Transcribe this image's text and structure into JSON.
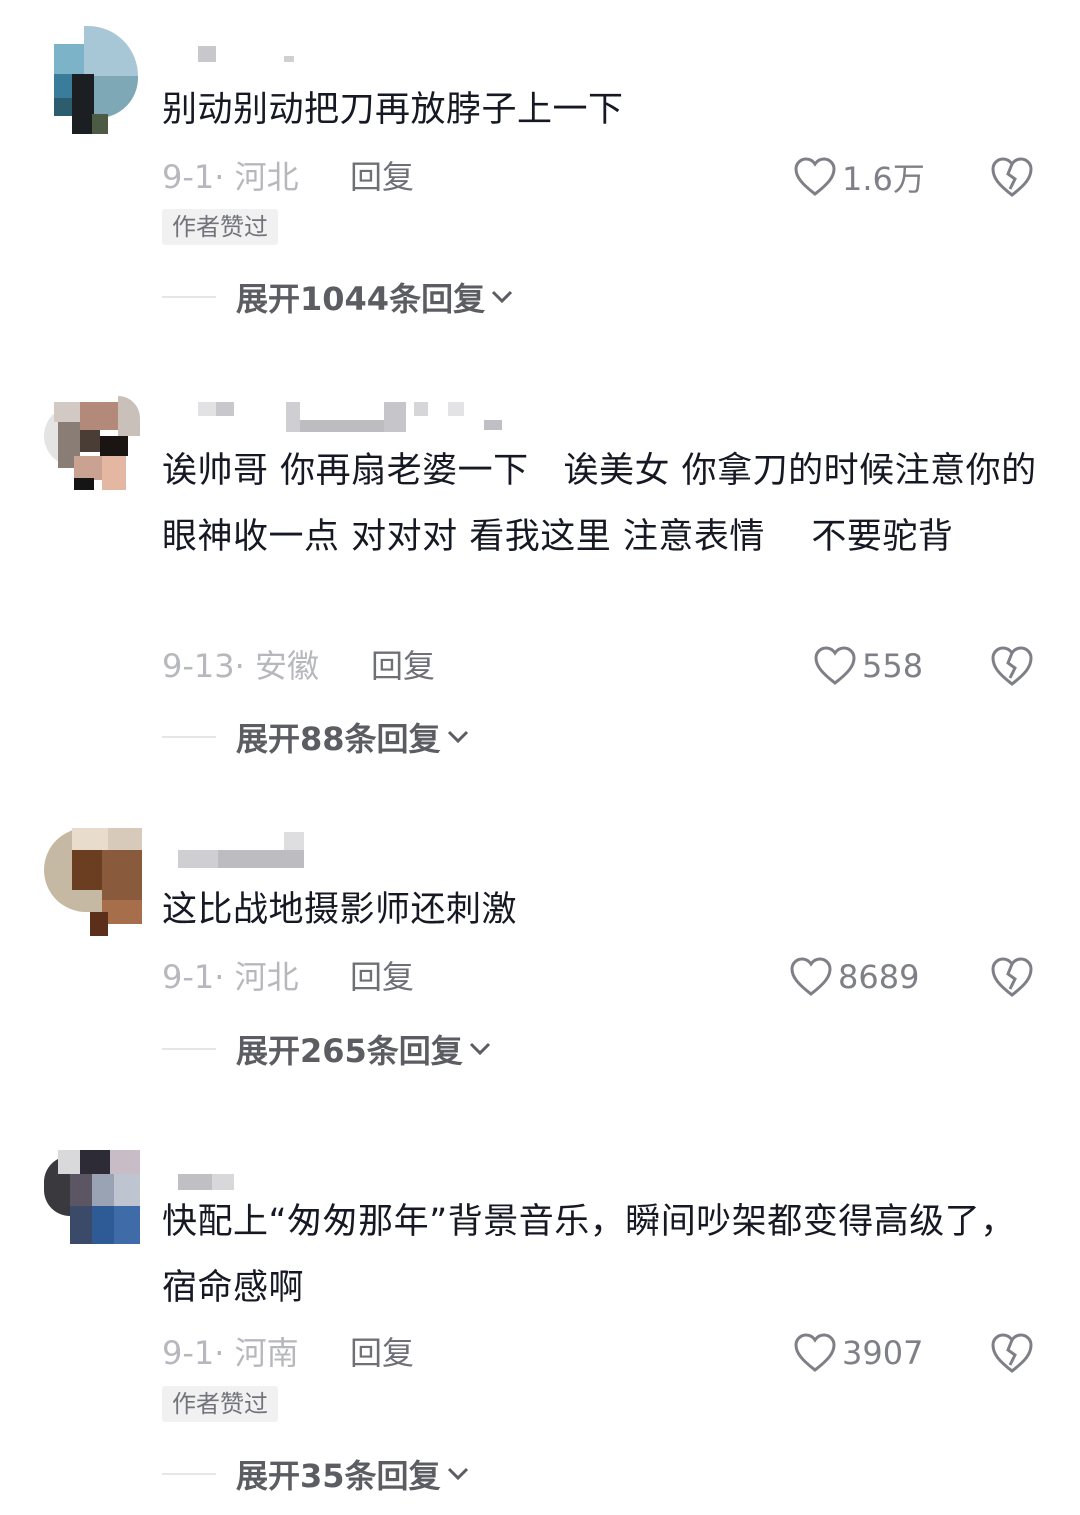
{
  "comments": [
    {
      "text": "别动别动把刀再放脖子上一下",
      "date_location": "9-1· 河北",
      "reply_label": "回复",
      "likes": "1.6万",
      "author_liked": "作者赞过",
      "expand_label": "展开1044条回复"
    },
    {
      "text": "诶帅哥 你再扇老婆一下   诶美女 你拿刀的时候注意你的眼神收一点 对对对 看我这里 注意表情    不要驼背",
      "date_location": "9-13· 安徽",
      "reply_label": "回复",
      "likes": "558",
      "expand_label": "展开88条回复"
    },
    {
      "text": "这比战地摄影师还刺激",
      "date_location": "9-1· 河北",
      "reply_label": "回复",
      "likes": "8689",
      "expand_label": "展开265条回复"
    },
    {
      "text": "快配上“匆匆那年”背景音乐，瞬间吵架都变得高级了，宿命感啊",
      "date_location": "9-1· 河南",
      "reply_label": "回复",
      "likes": "3907",
      "author_liked": "作者赞过",
      "expand_label": "展开35条回复"
    }
  ],
  "icons": {
    "like": "heart-outline-icon",
    "dislike": "broken-heart-icon",
    "expand": "chevron-down-icon"
  },
  "colors": {
    "text": "#161823",
    "meta": "#b7b8bd",
    "reply": "#6f7077",
    "badge_bg": "#f1f1f2"
  }
}
